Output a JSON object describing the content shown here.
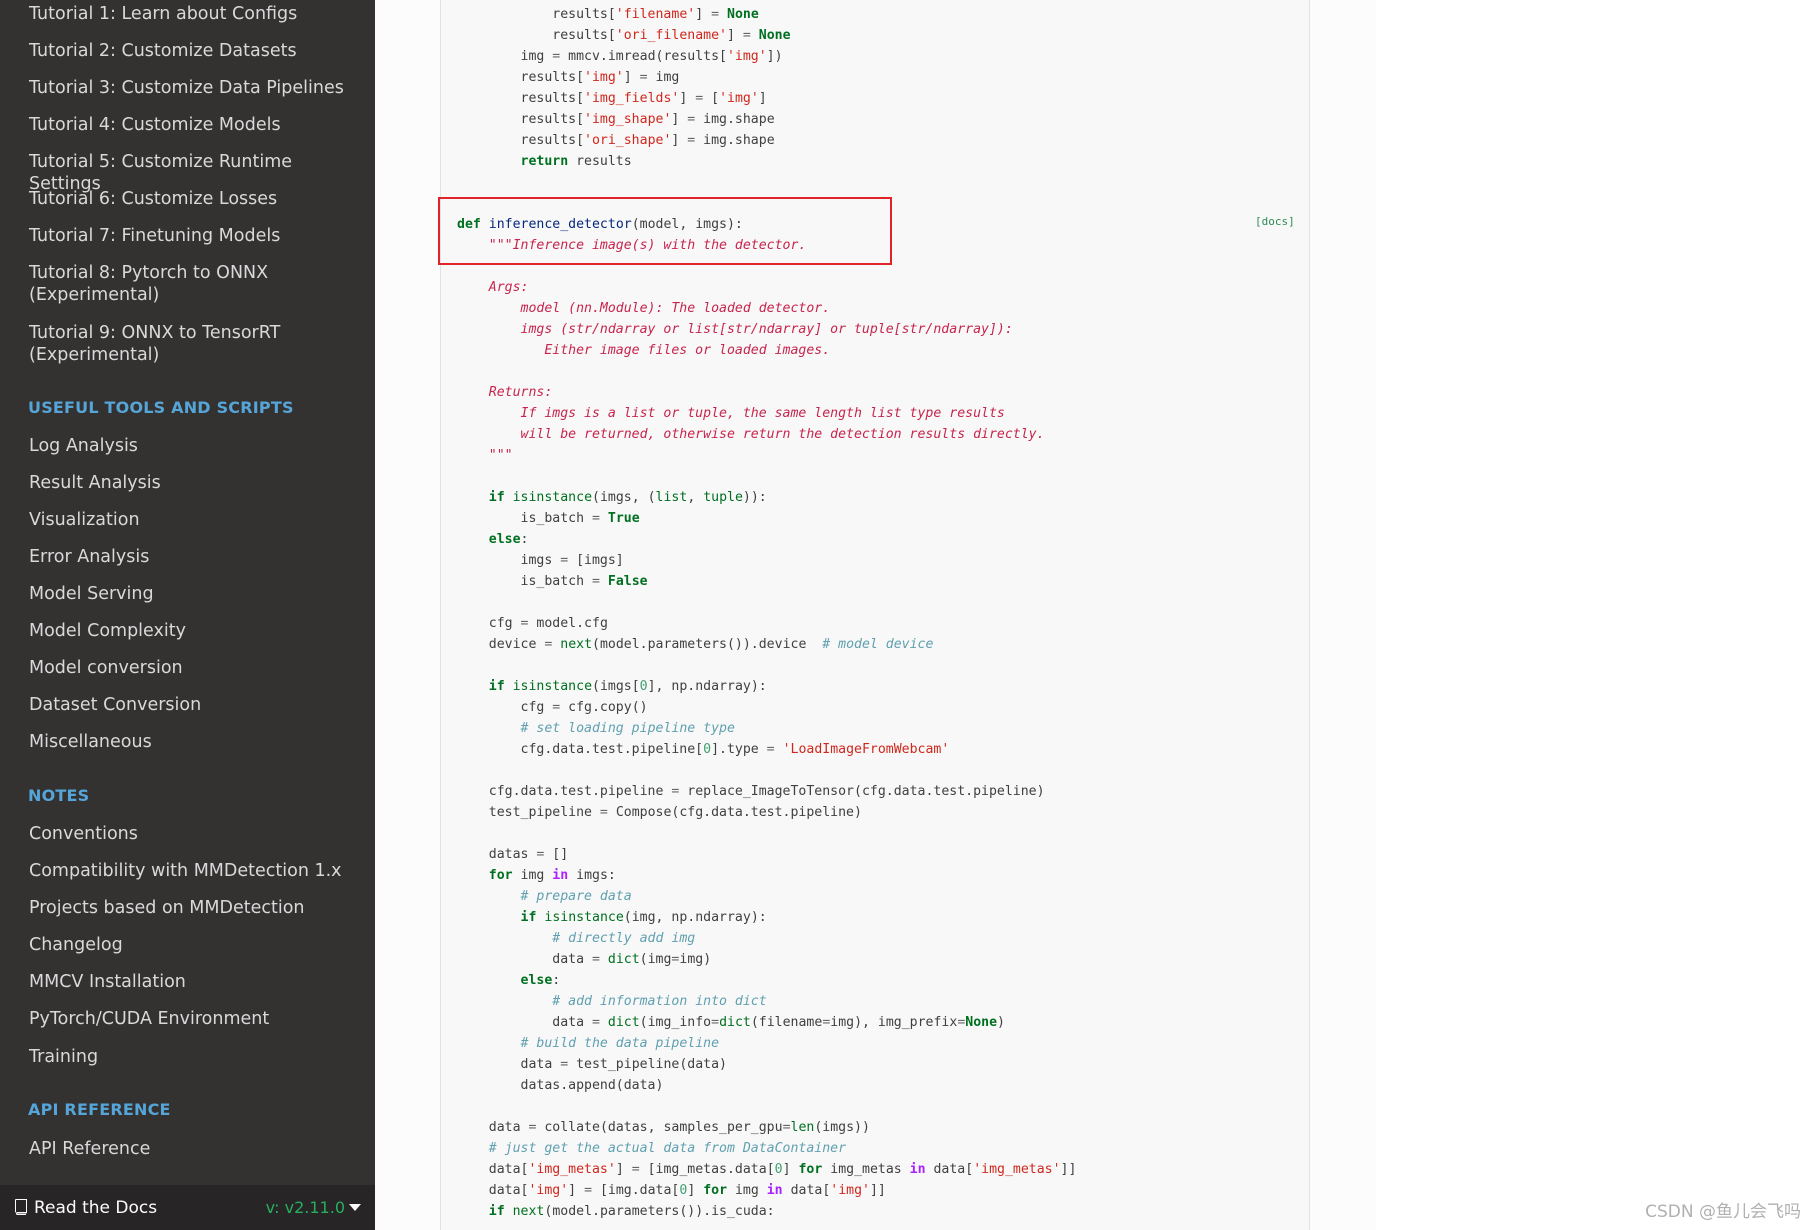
{
  "sidebar": {
    "tutorials": [
      "Tutorial 1: Learn about Configs",
      "Tutorial 2: Customize Datasets",
      "Tutorial 3: Customize Data Pipelines",
      "Tutorial 4: Customize Models",
      "Tutorial 5: Customize Runtime Settings",
      "Tutorial 6: Customize Losses",
      "Tutorial 7: Finetuning Models",
      "Tutorial 8: Pytorch to ONNX",
      "(Experimental)",
      "Tutorial 9: ONNX to TensorRT",
      "(Experimental)"
    ],
    "useful_tools_caption": "USEFUL TOOLS AND SCRIPTS",
    "useful_tools": [
      "Log Analysis",
      "Result Analysis",
      "Visualization",
      "Error Analysis",
      "Model Serving",
      "Model Complexity",
      "Model conversion",
      "Dataset Conversion",
      "Miscellaneous"
    ],
    "notes_caption": "NOTES",
    "notes": [
      "Conventions",
      "Compatibility with MMDetection 1.x",
      "Projects based on MMDetection",
      "Changelog",
      "MMCV Installation",
      "PyTorch/CUDA Environment",
      "Training"
    ],
    "api_caption": "API REFERENCE",
    "api": [
      "API Reference"
    ],
    "rtd_label": "Read the Docs",
    "version": "v: v2.11.0"
  },
  "code": {
    "docs_link": "[docs]",
    "lines": [
      "            results['filename'] = None",
      "            results['ori_filename'] = None",
      "        img = mmcv.imread(results['img'])",
      "        results['img'] = img",
      "        results['img_fields'] = ['img']",
      "        results['img_shape'] = img.shape",
      "        results['ori_shape'] = img.shape",
      "        return results",
      "def inference_detector(model, imgs):",
      "    \"\"\"Inference image(s) with the detector.",
      "    Args:",
      "        model (nn.Module): The loaded detector.",
      "        imgs (str/ndarray or list[str/ndarray] or tuple[str/ndarray]):",
      "           Either image files or loaded images.",
      "    Returns:",
      "        If imgs is a list or tuple, the same length list type results",
      "        will be returned, otherwise return the detection results directly.",
      "    \"\"\"",
      "    if isinstance(imgs, (list, tuple)):",
      "        is_batch = True",
      "    else:",
      "        imgs = [imgs]",
      "        is_batch = False",
      "    cfg = model.cfg",
      "    device = next(model.parameters()).device  # model device",
      "    if isinstance(imgs[0], np.ndarray):",
      "        cfg = cfg.copy()",
      "        # set loading pipeline type",
      "        cfg.data.test.pipeline[0].type = 'LoadImageFromWebcam'",
      "    cfg.data.test.pipeline = replace_ImageToTensor(cfg.data.test.pipeline)",
      "    test_pipeline = Compose(cfg.data.test.pipeline)",
      "    datas = []",
      "    for img in imgs:",
      "        # prepare data",
      "        if isinstance(img, np.ndarray):",
      "            # directly add img",
      "            data = dict(img=img)",
      "        else:",
      "            # add information into dict",
      "            data = dict(img_info=dict(filename=img), img_prefix=None)",
      "        # build the data pipeline",
      "        data = test_pipeline(data)",
      "        datas.append(data)",
      "    data = collate(datas, samples_per_gpu=len(imgs))",
      "    # just get the actual data from DataContainer",
      "    data['img_metas'] = [img_metas.data[0] for img_metas in data['img_metas']]",
      "    data['img'] = [img.data[0] for img in data['img']]",
      "    if next(model.parameters()).is_cuda:"
    ]
  },
  "watermark": "CSDN @鱼儿会飞吗",
  "colors": {
    "sidebar_bg": "#343131",
    "caption": "#55a5d9",
    "highlight_box": "#e2232a",
    "version": "#27ae60"
  }
}
